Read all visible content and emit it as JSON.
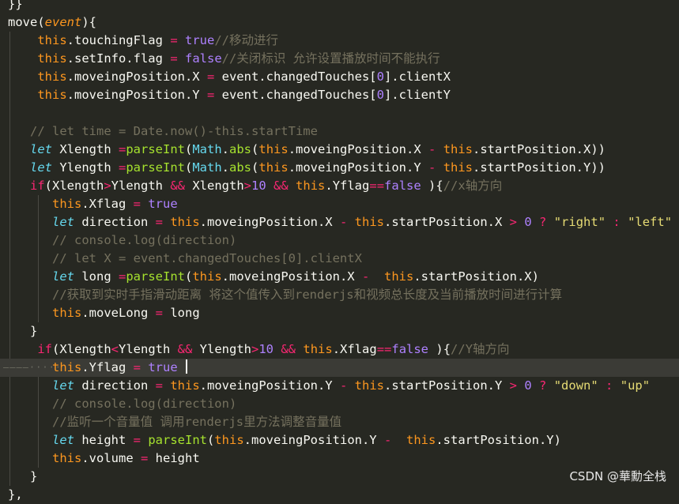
{
  "editor": {
    "lines": [
      {
        "guides": [],
        "tokens": [
          {
            "t": "}}",
            "c": "plain"
          }
        ]
      },
      {
        "guides": [],
        "tokens": [
          {
            "t": "move",
            "c": "plain"
          },
          {
            "t": "(",
            "c": "plain"
          },
          {
            "t": "event",
            "c": "param"
          },
          {
            "t": "){",
            "c": "plain"
          }
        ]
      },
      {
        "guides": [
          10
        ],
        "tokens": [
          {
            "t": "    ",
            "c": "plain"
          },
          {
            "t": "this",
            "c": "this"
          },
          {
            "t": ".touchingFlag ",
            "c": "plain"
          },
          {
            "t": "=",
            "c": "op"
          },
          {
            "t": " ",
            "c": "plain"
          },
          {
            "t": "true",
            "c": "bool"
          },
          {
            "t": "//移动进行",
            "c": "cmt"
          }
        ]
      },
      {
        "guides": [
          10
        ],
        "tokens": [
          {
            "t": "    ",
            "c": "plain"
          },
          {
            "t": "this",
            "c": "this"
          },
          {
            "t": ".setInfo.flag ",
            "c": "plain"
          },
          {
            "t": "=",
            "c": "op"
          },
          {
            "t": " ",
            "c": "plain"
          },
          {
            "t": "false",
            "c": "bool"
          },
          {
            "t": "//关闭标识 允许设置播放时间不能执行",
            "c": "cmt"
          }
        ]
      },
      {
        "guides": [
          10
        ],
        "tokens": [
          {
            "t": "    ",
            "c": "plain"
          },
          {
            "t": "this",
            "c": "this"
          },
          {
            "t": ".moveingPosition.X ",
            "c": "plain"
          },
          {
            "t": "=",
            "c": "op"
          },
          {
            "t": " event.changedTouches[",
            "c": "plain"
          },
          {
            "t": "0",
            "c": "num"
          },
          {
            "t": "].clientX",
            "c": "plain"
          }
        ]
      },
      {
        "guides": [
          10
        ],
        "tokens": [
          {
            "t": "    ",
            "c": "plain"
          },
          {
            "t": "this",
            "c": "this"
          },
          {
            "t": ".moveingPosition.Y ",
            "c": "plain"
          },
          {
            "t": "=",
            "c": "op"
          },
          {
            "t": " event.changedTouches[",
            "c": "plain"
          },
          {
            "t": "0",
            "c": "num"
          },
          {
            "t": "].clientY",
            "c": "plain"
          }
        ]
      },
      {
        "guides": [
          10
        ],
        "tokens": []
      },
      {
        "guides": [
          10
        ],
        "tokens": [
          {
            "t": "   // let time = Date.now()-this.startTime",
            "c": "cmt"
          }
        ]
      },
      {
        "guides": [
          10
        ],
        "tokens": [
          {
            "t": "   ",
            "c": "plain"
          },
          {
            "t": "let",
            "c": "store"
          },
          {
            "t": " Xlength ",
            "c": "plain"
          },
          {
            "t": "=",
            "c": "op"
          },
          {
            "t": "parseInt",
            "c": "fn"
          },
          {
            "t": "(",
            "c": "plain"
          },
          {
            "t": "Math",
            "c": "cls"
          },
          {
            "t": ".",
            "c": "plain"
          },
          {
            "t": "abs",
            "c": "fn"
          },
          {
            "t": "(",
            "c": "plain"
          },
          {
            "t": "this",
            "c": "this"
          },
          {
            "t": ".moveingPosition.X ",
            "c": "plain"
          },
          {
            "t": "-",
            "c": "op"
          },
          {
            "t": " ",
            "c": "plain"
          },
          {
            "t": "this",
            "c": "this"
          },
          {
            "t": ".startPosition.X))",
            "c": "plain"
          }
        ]
      },
      {
        "guides": [
          10
        ],
        "tokens": [
          {
            "t": "   ",
            "c": "plain"
          },
          {
            "t": "let",
            "c": "store"
          },
          {
            "t": " Ylength ",
            "c": "plain"
          },
          {
            "t": "=",
            "c": "op"
          },
          {
            "t": "parseInt",
            "c": "fn"
          },
          {
            "t": "(",
            "c": "plain"
          },
          {
            "t": "Math",
            "c": "cls"
          },
          {
            "t": ".",
            "c": "plain"
          },
          {
            "t": "abs",
            "c": "fn"
          },
          {
            "t": "(",
            "c": "plain"
          },
          {
            "t": "this",
            "c": "this"
          },
          {
            "t": ".moveingPosition.Y ",
            "c": "plain"
          },
          {
            "t": "-",
            "c": "op"
          },
          {
            "t": " ",
            "c": "plain"
          },
          {
            "t": "this",
            "c": "this"
          },
          {
            "t": ".startPosition.Y))",
            "c": "plain"
          }
        ]
      },
      {
        "guides": [
          10
        ],
        "tokens": [
          {
            "t": "   ",
            "c": "plain"
          },
          {
            "t": "if",
            "c": "kw"
          },
          {
            "t": "(Xlength",
            "c": "plain"
          },
          {
            "t": ">",
            "c": "op"
          },
          {
            "t": "Ylength ",
            "c": "plain"
          },
          {
            "t": "&&",
            "c": "op"
          },
          {
            "t": " Xlength",
            "c": "plain"
          },
          {
            "t": ">",
            "c": "op"
          },
          {
            "t": "10",
            "c": "num"
          },
          {
            "t": " ",
            "c": "plain"
          },
          {
            "t": "&&",
            "c": "op"
          },
          {
            "t": " ",
            "c": "plain"
          },
          {
            "t": "this",
            "c": "this"
          },
          {
            "t": ".Yflag",
            "c": "plain"
          },
          {
            "t": "==",
            "c": "op"
          },
          {
            "t": "false",
            "c": "bool"
          },
          {
            "t": " ){",
            "c": "plain"
          },
          {
            "t": "//x轴方向",
            "c": "cmt"
          }
        ]
      },
      {
        "guides": [
          10,
          46
        ],
        "tokens": [
          {
            "t": "      ",
            "c": "plain"
          },
          {
            "t": "this",
            "c": "this"
          },
          {
            "t": ".Xflag ",
            "c": "plain"
          },
          {
            "t": "=",
            "c": "op"
          },
          {
            "t": " ",
            "c": "plain"
          },
          {
            "t": "true",
            "c": "bool"
          }
        ]
      },
      {
        "guides": [
          10,
          46
        ],
        "tokens": [
          {
            "t": "      ",
            "c": "plain"
          },
          {
            "t": "let",
            "c": "store"
          },
          {
            "t": " direction ",
            "c": "plain"
          },
          {
            "t": "=",
            "c": "op"
          },
          {
            "t": " ",
            "c": "plain"
          },
          {
            "t": "this",
            "c": "this"
          },
          {
            "t": ".moveingPosition.X ",
            "c": "plain"
          },
          {
            "t": "-",
            "c": "op"
          },
          {
            "t": " ",
            "c": "plain"
          },
          {
            "t": "this",
            "c": "this"
          },
          {
            "t": ".startPosition.X ",
            "c": "plain"
          },
          {
            "t": ">",
            "c": "op"
          },
          {
            "t": " ",
            "c": "plain"
          },
          {
            "t": "0",
            "c": "num"
          },
          {
            "t": " ",
            "c": "plain"
          },
          {
            "t": "?",
            "c": "op"
          },
          {
            "t": " ",
            "c": "plain"
          },
          {
            "t": "\"right\"",
            "c": "str"
          },
          {
            "t": " ",
            "c": "plain"
          },
          {
            "t": ":",
            "c": "op"
          },
          {
            "t": " ",
            "c": "plain"
          },
          {
            "t": "\"left\"",
            "c": "str"
          }
        ]
      },
      {
        "guides": [
          10,
          46
        ],
        "tokens": [
          {
            "t": "      // console.log(direction)",
            "c": "cmt"
          }
        ]
      },
      {
        "guides": [
          10,
          46
        ],
        "tokens": [
          {
            "t": "      // let X = event.changedTouches[0].clientX",
            "c": "cmt"
          }
        ]
      },
      {
        "guides": [
          10,
          46
        ],
        "tokens": [
          {
            "t": "      ",
            "c": "plain"
          },
          {
            "t": "let",
            "c": "store"
          },
          {
            "t": " long ",
            "c": "plain"
          },
          {
            "t": "=",
            "c": "op"
          },
          {
            "t": "parseInt",
            "c": "fn"
          },
          {
            "t": "(",
            "c": "plain"
          },
          {
            "t": "this",
            "c": "this"
          },
          {
            "t": ".moveingPosition.X ",
            "c": "plain"
          },
          {
            "t": "-",
            "c": "op"
          },
          {
            "t": "  ",
            "c": "plain"
          },
          {
            "t": "this",
            "c": "this"
          },
          {
            "t": ".startPosition.X)",
            "c": "plain"
          }
        ]
      },
      {
        "guides": [
          10,
          46
        ],
        "tokens": [
          {
            "t": "      //获取到实时手指滑动距离 将这个值传入到renderjs和视频总长度及当前播放时间进行计算",
            "c": "cmt"
          }
        ]
      },
      {
        "guides": [
          10,
          46
        ],
        "tokens": [
          {
            "t": "      ",
            "c": "plain"
          },
          {
            "t": "this",
            "c": "this"
          },
          {
            "t": ".moveLong ",
            "c": "plain"
          },
          {
            "t": "=",
            "c": "op"
          },
          {
            "t": " long",
            "c": "plain"
          }
        ]
      },
      {
        "guides": [
          10
        ],
        "tokens": [
          {
            "t": "   }",
            "c": "plain"
          }
        ]
      },
      {
        "guides": [
          10
        ],
        "tokens": [
          {
            "t": "    ",
            "c": "plain"
          },
          {
            "t": "if",
            "c": "kw"
          },
          {
            "t": "(Xlength",
            "c": "plain"
          },
          {
            "t": "<",
            "c": "op"
          },
          {
            "t": "Ylength ",
            "c": "plain"
          },
          {
            "t": "&&",
            "c": "op"
          },
          {
            "t": " Ylength",
            "c": "plain"
          },
          {
            "t": ">",
            "c": "op"
          },
          {
            "t": "10",
            "c": "num"
          },
          {
            "t": " ",
            "c": "plain"
          },
          {
            "t": "&&",
            "c": "op"
          },
          {
            "t": " ",
            "c": "plain"
          },
          {
            "t": "this",
            "c": "this"
          },
          {
            "t": ".Xflag",
            "c": "plain"
          },
          {
            "t": "==",
            "c": "op"
          },
          {
            "t": "false",
            "c": "bool"
          },
          {
            "t": " ){",
            "c": "plain"
          },
          {
            "t": "//Y轴方向",
            "c": "cmt"
          }
        ]
      },
      {
        "guides": [],
        "current": true,
        "tokens": [
          {
            "t": "      ",
            "c": "plain"
          },
          {
            "t": "this",
            "c": "this"
          },
          {
            "t": ".Yflag ",
            "c": "plain"
          },
          {
            "t": "=",
            "c": "op"
          },
          {
            "t": " ",
            "c": "plain"
          },
          {
            "t": "true",
            "c": "bool"
          },
          {
            "t": " ",
            "c": "plain"
          }
        ]
      },
      {
        "guides": [
          10,
          46
        ],
        "tokens": [
          {
            "t": "      ",
            "c": "plain"
          },
          {
            "t": "let",
            "c": "store"
          },
          {
            "t": " direction ",
            "c": "plain"
          },
          {
            "t": "=",
            "c": "op"
          },
          {
            "t": " ",
            "c": "plain"
          },
          {
            "t": "this",
            "c": "this"
          },
          {
            "t": ".moveingPosition.Y ",
            "c": "plain"
          },
          {
            "t": "-",
            "c": "op"
          },
          {
            "t": " ",
            "c": "plain"
          },
          {
            "t": "this",
            "c": "this"
          },
          {
            "t": ".startPosition.Y ",
            "c": "plain"
          },
          {
            "t": ">",
            "c": "op"
          },
          {
            "t": " ",
            "c": "plain"
          },
          {
            "t": "0",
            "c": "num"
          },
          {
            "t": " ",
            "c": "plain"
          },
          {
            "t": "?",
            "c": "op"
          },
          {
            "t": " ",
            "c": "plain"
          },
          {
            "t": "\"down\"",
            "c": "str"
          },
          {
            "t": " ",
            "c": "plain"
          },
          {
            "t": ":",
            "c": "op"
          },
          {
            "t": " ",
            "c": "plain"
          },
          {
            "t": "\"up\"",
            "c": "str"
          }
        ]
      },
      {
        "guides": [
          10,
          46
        ],
        "tokens": [
          {
            "t": "      // console.log(direction)",
            "c": "cmt"
          }
        ]
      },
      {
        "guides": [
          10,
          46
        ],
        "tokens": [
          {
            "t": "      //监听一个音量值 调用renderjs里方法调整音量值",
            "c": "cmt"
          }
        ]
      },
      {
        "guides": [
          10,
          46
        ],
        "tokens": [
          {
            "t": "      ",
            "c": "plain"
          },
          {
            "t": "let",
            "c": "store"
          },
          {
            "t": " height ",
            "c": "plain"
          },
          {
            "t": "=",
            "c": "op"
          },
          {
            "t": " ",
            "c": "plain"
          },
          {
            "t": "parseInt",
            "c": "fn"
          },
          {
            "t": "(",
            "c": "plain"
          },
          {
            "t": "this",
            "c": "this"
          },
          {
            "t": ".moveingPosition.Y ",
            "c": "plain"
          },
          {
            "t": "-",
            "c": "op"
          },
          {
            "t": "  ",
            "c": "plain"
          },
          {
            "t": "this",
            "c": "this"
          },
          {
            "t": ".startPosition.Y)",
            "c": "plain"
          }
        ]
      },
      {
        "guides": [
          10,
          46
        ],
        "tokens": [
          {
            "t": "      ",
            "c": "plain"
          },
          {
            "t": "this",
            "c": "this"
          },
          {
            "t": ".volume ",
            "c": "plain"
          },
          {
            "t": "=",
            "c": "op"
          },
          {
            "t": " height",
            "c": "plain"
          }
        ]
      },
      {
        "guides": [
          10
        ],
        "tokens": [
          {
            "t": "   }",
            "c": "plain"
          }
        ]
      },
      {
        "guides": [],
        "tokens": [
          {
            "t": "},",
            "c": "plain"
          }
        ]
      }
    ]
  },
  "watermark": "CSDN @華勳全栈"
}
